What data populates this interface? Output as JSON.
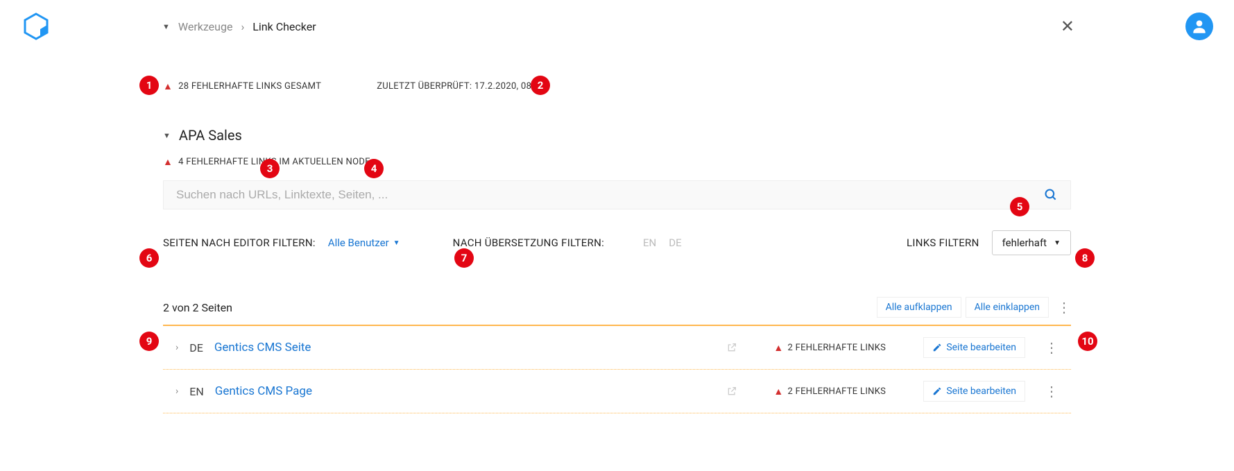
{
  "breadcrumb": {
    "parent": "Werkzeuge",
    "current": "Link Checker"
  },
  "summary": {
    "total_broken_label": "28 FEHLERHAFTE LINKS GESAMT",
    "last_checked_label": "ZULETZT ÜBERPRÜFT: 17.2.2020, 08:08"
  },
  "node": {
    "name": "APA Sales",
    "broken_label": "4 FEHLERHAFTE LINKS IM AKTUELLEN NODE"
  },
  "search": {
    "placeholder": "Suchen nach URLs, Linktexte, Seiten, ..."
  },
  "filters": {
    "editor_label": "SEITEN NACH EDITOR FILTERN:",
    "editor_value": "Alle Benutzer",
    "translation_label": "NACH ÜBERSETZUNG FILTERN:",
    "lang_en": "EN",
    "lang_de": "DE",
    "links_label": "LINKS FILTERN",
    "links_value": "fehlerhaft"
  },
  "results": {
    "count_label": "2 von 2 Seiten",
    "expand_all": "Alle aufklappen",
    "collapse_all": "Alle einklappen",
    "rows": [
      {
        "lang": "DE",
        "title": "Gentics CMS Seite",
        "warn": "2 FEHLERHAFTE LINKS",
        "edit": "Seite bearbeiten"
      },
      {
        "lang": "EN",
        "title": "Gentics CMS Page",
        "warn": "2 FEHLERHAFTE LINKS",
        "edit": "Seite bearbeiten"
      }
    ]
  },
  "callouts": [
    "1",
    "2",
    "3",
    "4",
    "5",
    "6",
    "7",
    "8",
    "9",
    "10"
  ]
}
